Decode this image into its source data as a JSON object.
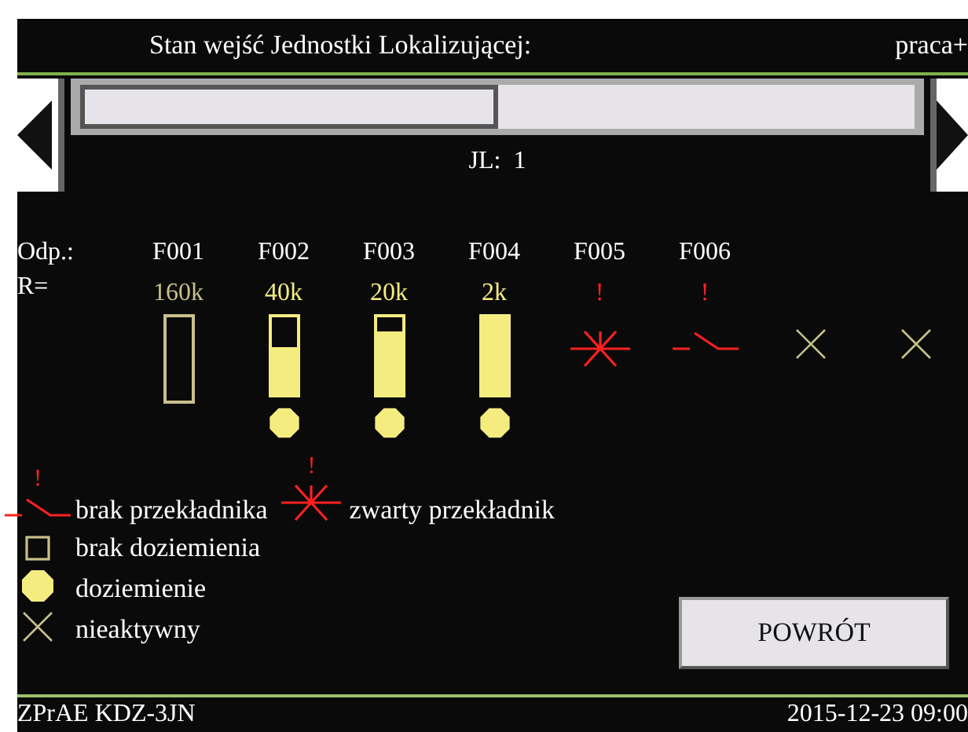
{
  "header": {
    "title": "Stan wejść Jednostki Lokalizującej:",
    "mode": "praca+"
  },
  "selector": {
    "label": "JL:",
    "value": "1"
  },
  "channels_header": {
    "label": "Odp.:",
    "resistance_label": "R="
  },
  "channels": [
    {
      "kind": "bar",
      "label": "F001",
      "resistance": "160k",
      "level": 0,
      "grounded": false
    },
    {
      "kind": "bar",
      "label": "F002",
      "resistance": "40k",
      "level": 0.62,
      "grounded": true
    },
    {
      "kind": "bar",
      "label": "F003",
      "resistance": "20k",
      "level": 0.82,
      "grounded": true
    },
    {
      "kind": "bar",
      "label": "F004",
      "resistance": "2k",
      "level": 1,
      "grounded": true
    },
    {
      "kind": "short",
      "label": "F005",
      "mark": "!"
    },
    {
      "kind": "open",
      "label": "F006",
      "mark": "!"
    },
    {
      "kind": "inactive"
    },
    {
      "kind": "inactive"
    }
  ],
  "legend": [
    {
      "items": [
        {
          "kind": "open",
          "mark": "!",
          "text": "brak przekładnika"
        },
        {
          "kind": "short",
          "mark": "!",
          "text": "zwarty przekładnik"
        }
      ]
    },
    {
      "items": [
        {
          "kind": "outline",
          "text": "brak doziemienia"
        }
      ]
    },
    {
      "items": [
        {
          "kind": "dot",
          "text": "doziemienie"
        }
      ]
    },
    {
      "items": [
        {
          "kind": "inactive",
          "text": "nieaktywny"
        }
      ]
    }
  ],
  "back_button": "POWRÓT",
  "status_bar": {
    "device": "ZPrAE KDZ-3JN",
    "datetime": "2015-12-23 09:00"
  }
}
